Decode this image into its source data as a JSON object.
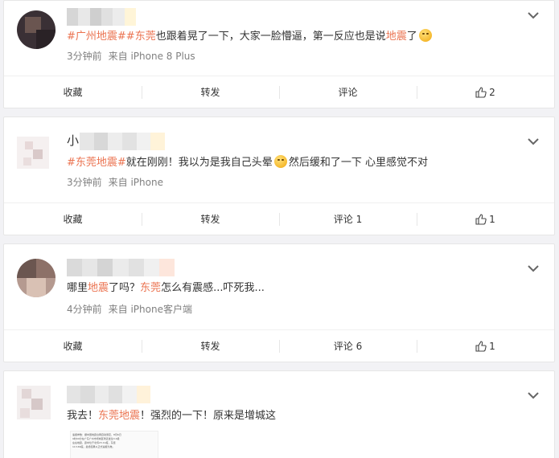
{
  "posts": [
    {
      "content_parts": [
        "#广州地震#",
        "#东莞",
        "也跟着晃了一下，大家一脸懵逼，第一反应也是说",
        "地震",
        "了"
      ],
      "time": "3分钟前",
      "source": "来自 iPhone 8 Plus",
      "actions": {
        "collect": "收藏",
        "forward": "转发",
        "comment": "评论",
        "like_count": "2"
      }
    },
    {
      "name_prefix": "小",
      "content_parts": [
        "#东莞地震#",
        "就在刚刚！我以为是我自己头晕",
        "然后缓和了一下 心里感觉不对"
      ],
      "time": "3分钟前",
      "source": "来自 iPhone",
      "actions": {
        "collect": "收藏",
        "forward": "转发",
        "comment": "评论 1",
        "like_count": "1"
      }
    },
    {
      "content_parts": [
        "哪里",
        "地震",
        "了吗？",
        "东莞",
        "怎么有震感...吓死我..."
      ],
      "time": "4分钟前",
      "source": "来自 iPhone客户端",
      "actions": {
        "collect": "收藏",
        "forward": "转发",
        "comment": "评论 6",
        "like_count": "1"
      }
    },
    {
      "content_parts": [
        "我去！",
        "东莞地震",
        "！强烈的一下！原来是增城这"
      ],
      "attachment_lines": [
        "速报参数：据中国地震台网自动测定，8月6日",
        "9时09分在广东广州市增城区附近发生3.0级",
        "左右地震，震中位于北纬23.19度，东经",
        "113.66度。最终结果以正式速报为准。"
      ]
    }
  ],
  "colors": {
    "highlight": "#eb7350",
    "text": "#333333",
    "meta": "#808080",
    "background": "#f2f2f5"
  },
  "icons": [
    "chevron-down-icon",
    "thumbs-up-icon",
    "emoji-icon"
  ]
}
